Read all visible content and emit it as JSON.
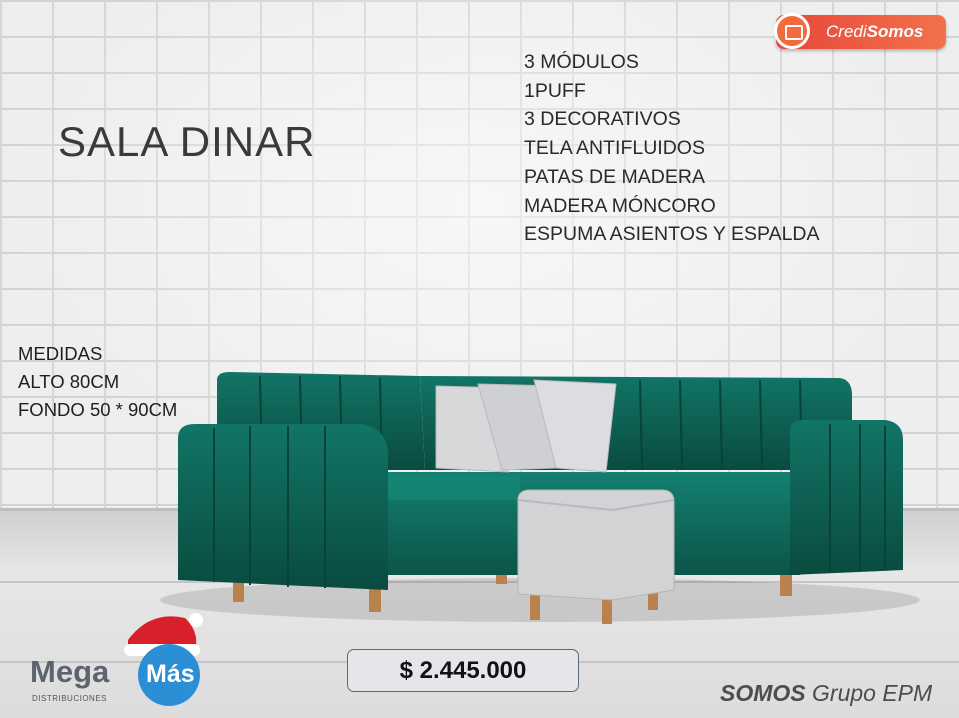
{
  "title": "SALA DINAR",
  "features": [
    "3 MÓDULOS",
    "1PUFF",
    "3 DECORATIVOS",
    "TELA ANTIFLUIDOS",
    "PATAS DE MADERA",
    "MADERA MÓNCORO",
    "ESPUMA ASIENTOS Y ESPALDA"
  ],
  "measures": {
    "heading": "MEDIDAS",
    "height": "ALTO 80CM",
    "depth": "FONDO 50 * 90CM"
  },
  "price": "$ 2.445.000",
  "brands": {
    "credi_prefix": "Credi",
    "credi_suffix": "Somos",
    "mega": "Mega",
    "mas": "Más",
    "distribuciones": "DISTRIBUCIONES",
    "somos": "SOMOS",
    "grupo": " Grupo EPM"
  },
  "colors": {
    "sofa": "#0d5e50",
    "pillow": "#d7d8da",
    "legs": "#b9814b",
    "credi": "#ee5a3e",
    "mas": "#2c8fd6"
  }
}
